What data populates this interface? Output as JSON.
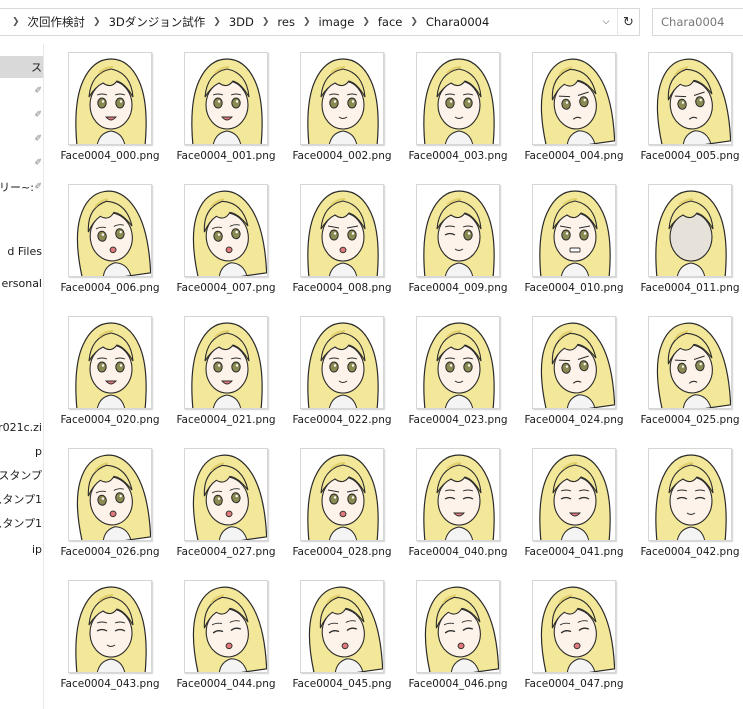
{
  "window": {
    "breadcrumb": [
      "次回作検討",
      "3Dダンジョン試作",
      "3DD",
      "res",
      "image",
      "face",
      "Chara0004"
    ],
    "refresh_icon": "refresh-icon",
    "search_placeholder": "Chara0004"
  },
  "nav_items": [
    {
      "label": "ス",
      "pinned": false,
      "selected": true
    },
    {
      "label": "",
      "pinned": true,
      "selected": false
    },
    {
      "label": "",
      "pinned": true,
      "selected": false
    },
    {
      "label": "",
      "pinned": true,
      "selected": false
    },
    {
      "label": "",
      "pinned": true,
      "selected": false
    },
    {
      "label": "ーリー~:",
      "pinned": true,
      "selected": false
    },
    {
      "label": "d Files",
      "pinned": false,
      "selected": false
    },
    {
      "label": "ersonal",
      "pinned": false,
      "selected": false
    },
    {
      "label": "er021c.zi",
      "pinned": false,
      "selected": false
    },
    {
      "label": "p",
      "pinned": false,
      "selected": false
    },
    {
      "label": "Eスタンプ",
      "pinned": false,
      "selected": false
    },
    {
      "label": "スタンプ1",
      "pinned": false,
      "selected": false
    },
    {
      "label": "スタンプ1",
      "pinned": false,
      "selected": false
    },
    {
      "label": "ip",
      "pinned": false,
      "selected": false
    }
  ],
  "files": [
    {
      "name": "Face0004_000.png",
      "expr": "smile"
    },
    {
      "name": "Face0004_001.png",
      "expr": "smile"
    },
    {
      "name": "Face0004_002.png",
      "expr": "calm"
    },
    {
      "name": "Face0004_003.png",
      "expr": "calm"
    },
    {
      "name": "Face0004_004.png",
      "expr": "worried"
    },
    {
      "name": "Face0004_005.png",
      "expr": "worried"
    },
    {
      "name": "Face0004_006.png",
      "expr": "tilt"
    },
    {
      "name": "Face0004_007.png",
      "expr": "tilt"
    },
    {
      "name": "Face0004_008.png",
      "expr": "surprised"
    },
    {
      "name": "Face0004_009.png",
      "expr": "wink"
    },
    {
      "name": "Face0004_010.png",
      "expr": "grimace"
    },
    {
      "name": "Face0004_011.png",
      "expr": "blank"
    },
    {
      "name": "Face0004_020.png",
      "expr": "smile"
    },
    {
      "name": "Face0004_021.png",
      "expr": "smile"
    },
    {
      "name": "Face0004_022.png",
      "expr": "calm"
    },
    {
      "name": "Face0004_023.png",
      "expr": "calm"
    },
    {
      "name": "Face0004_024.png",
      "expr": "worried"
    },
    {
      "name": "Face0004_025.png",
      "expr": "worried"
    },
    {
      "name": "Face0004_026.png",
      "expr": "tilt"
    },
    {
      "name": "Face0004_027.png",
      "expr": "tilt"
    },
    {
      "name": "Face0004_028.png",
      "expr": "surprised"
    },
    {
      "name": "Face0004_040.png",
      "expr": "closed-smile"
    },
    {
      "name": "Face0004_041.png",
      "expr": "closed-smile"
    },
    {
      "name": "Face0004_042.png",
      "expr": "closed-calm"
    },
    {
      "name": "Face0004_043.png",
      "expr": "closed-calm"
    },
    {
      "name": "Face0004_044.png",
      "expr": "closed-tilt"
    },
    {
      "name": "Face0004_045.png",
      "expr": "closed-tilt"
    },
    {
      "name": "Face0004_046.png",
      "expr": "closed-tilt"
    },
    {
      "name": "Face0004_047.png",
      "expr": "closed-tilt"
    }
  ],
  "colors": {
    "hair": "#f3e79a",
    "hair_shade": "#e2cf6a",
    "skin": "#fdf3ea",
    "eye": "#8a8a52",
    "outline": "#2b2b2b",
    "mouth": "#e0797b"
  }
}
